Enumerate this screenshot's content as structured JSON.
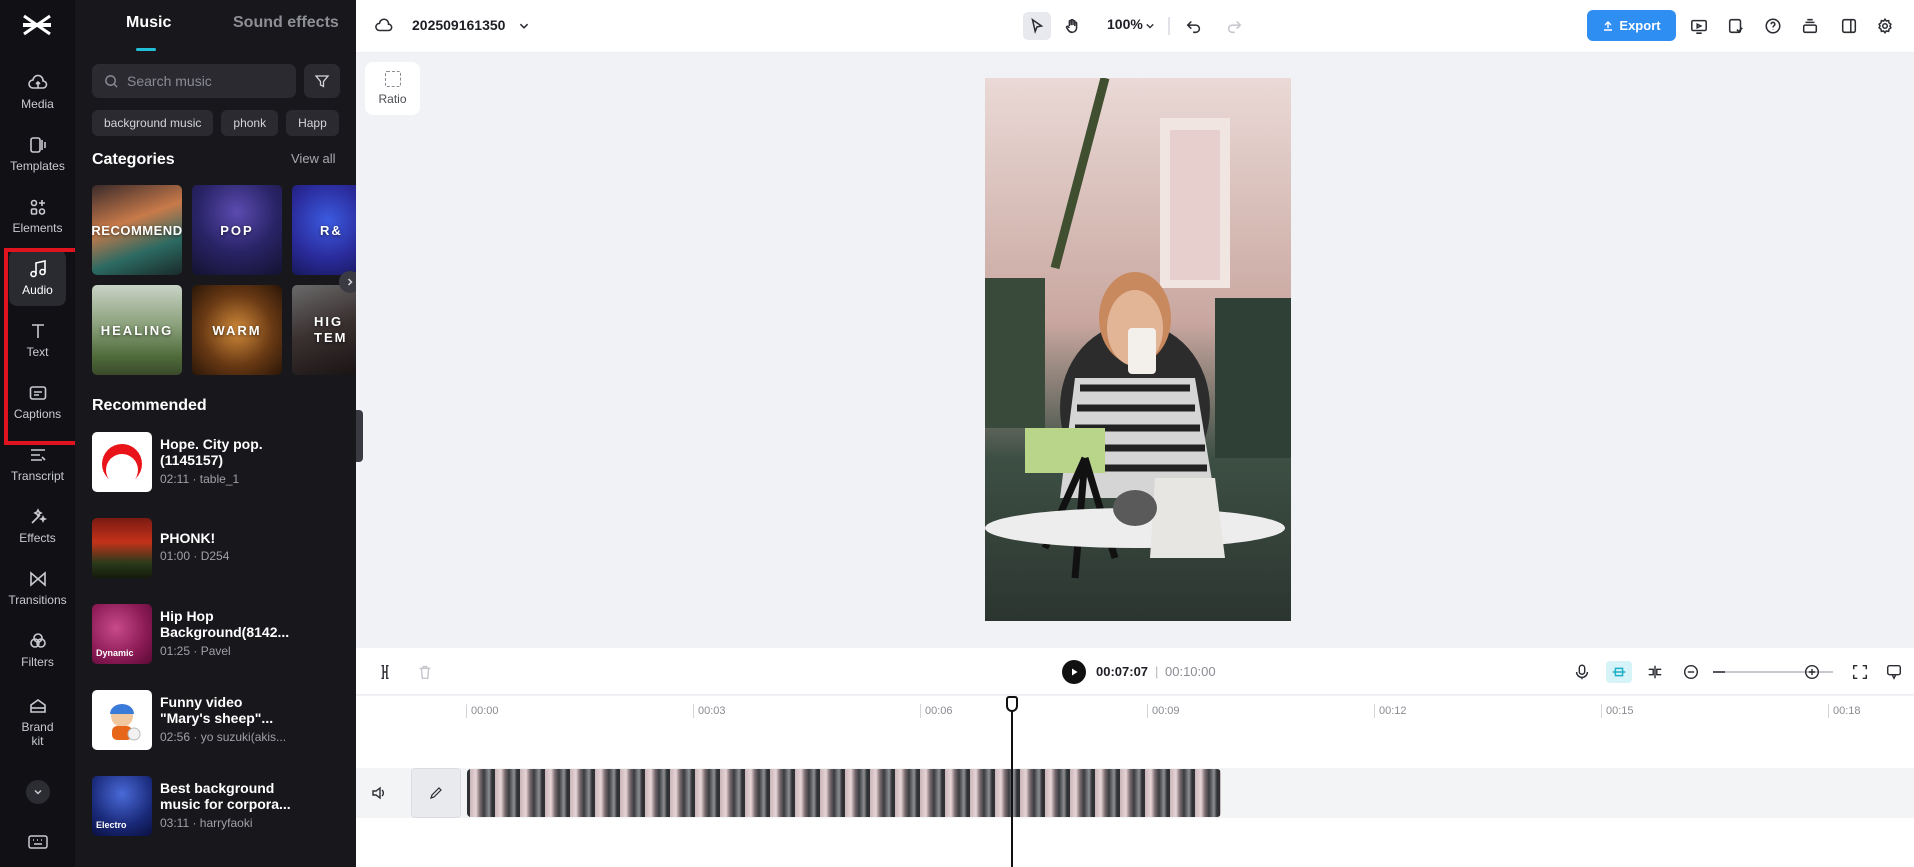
{
  "project": {
    "name": "202509161350"
  },
  "rail": {
    "items": [
      {
        "key": "media",
        "label": "Media",
        "icon": "cloud-upload-icon"
      },
      {
        "key": "templates",
        "label": "Templates",
        "icon": "template-icon"
      },
      {
        "key": "elements",
        "label": "Elements",
        "icon": "elements-icon"
      },
      {
        "key": "audio",
        "label": "Audio",
        "icon": "music-note-icon"
      },
      {
        "key": "text",
        "label": "Text",
        "icon": "text-icon"
      },
      {
        "key": "captions",
        "label": "Captions",
        "icon": "captions-icon"
      },
      {
        "key": "transcript",
        "label": "Transcript",
        "icon": "transcript-icon"
      },
      {
        "key": "effects",
        "label": "Effects",
        "icon": "effects-icon"
      },
      {
        "key": "transitions",
        "label": "Transitions",
        "icon": "transitions-icon"
      },
      {
        "key": "filters",
        "label": "Filters",
        "icon": "filters-icon"
      },
      {
        "key": "brandkit",
        "label": "Brand kit",
        "icon": "brand-kit-icon"
      }
    ],
    "active": "Audio"
  },
  "panel": {
    "tabs": [
      "Music",
      "Sound effects"
    ],
    "active_tab": "Music",
    "search_placeholder": "Search music",
    "chips": [
      "background music",
      "phonk",
      "Happ"
    ],
    "categories_title": "Categories",
    "view_all": "View all",
    "categories": [
      "RECOMMEND",
      "POP",
      "R&",
      "HEALING",
      "WARM",
      "HIG TEM"
    ],
    "recommended_title": "Recommended",
    "tracks": [
      {
        "title": "Hope. City pop.(1145157)",
        "meta": "02:11 · table_1"
      },
      {
        "title": "PHONK!",
        "meta": "01:00 · D254"
      },
      {
        "title": "Hip Hop Background(8142...",
        "meta": "01:25 · Pavel",
        "thumb_text": "Dynamic"
      },
      {
        "title": "Funny video \"Mary's sheep\"...",
        "meta": "02:56 · yo suzuki(akis..."
      },
      {
        "title": "Best background music for corpora...",
        "meta": "03:11 · harryfaoki",
        "thumb_text": "Electro"
      }
    ]
  },
  "topbar": {
    "zoom": "100%",
    "export_label": "Export"
  },
  "stage": {
    "ratio_label": "Ratio"
  },
  "playback": {
    "current_time": "00:07:07",
    "separator": "|",
    "total_time": "00:10:00"
  },
  "timeline": {
    "ticks": [
      "00:00",
      "00:03",
      "00:06",
      "00:09",
      "00:12",
      "00:15",
      "00:18"
    ],
    "playhead_time": "00:07:07"
  },
  "colors": {
    "accent": "#21c0d8",
    "export": "#2e8ef2",
    "highlight": "#e0141e"
  }
}
